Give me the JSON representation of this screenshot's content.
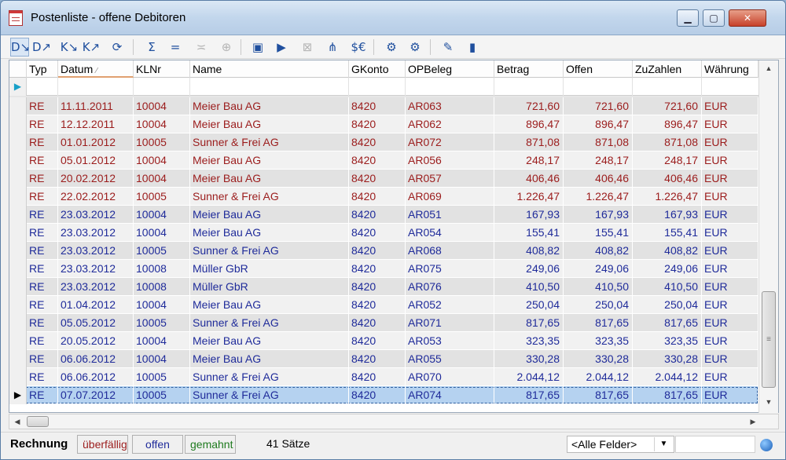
{
  "window": {
    "title": "Postenliste - offene Debitoren",
    "minimize": "▁",
    "maximize": "▢",
    "close": "✕"
  },
  "toolbar": {
    "icons": [
      "D↘",
      "D↗",
      "K↘",
      "K↗",
      "⟳",
      "Σ",
      "=",
      "≍",
      "⊕",
      "▣",
      "▶",
      "⊠",
      "⋔",
      "$€",
      "⚙",
      "⚙",
      "✎",
      "▮"
    ]
  },
  "grid": {
    "columns": [
      "Typ",
      "Datum",
      "KLNr",
      "Name",
      "GKonto",
      "OPBeleg",
      "Betrag",
      "Offen",
      "ZuZahlen",
      "Währung"
    ],
    "sort_indicator": "⁄",
    "new_row_marker": "▶",
    "current_row_marker": "▶",
    "rows": [
      {
        "typ": "RE",
        "datum": "11.11.2011",
        "klnr": "10004",
        "name": "Meier Bau AG",
        "gkonto": "8420",
        "opbeleg": "AR063",
        "betrag": "721,60",
        "offen": "721,60",
        "zuzahlen": "721,60",
        "waehrung": "EUR",
        "status": "overdue"
      },
      {
        "typ": "RE",
        "datum": "12.12.2011",
        "klnr": "10004",
        "name": "Meier Bau AG",
        "gkonto": "8420",
        "opbeleg": "AR062",
        "betrag": "896,47",
        "offen": "896,47",
        "zuzahlen": "896,47",
        "waehrung": "EUR",
        "status": "overdue"
      },
      {
        "typ": "RE",
        "datum": "01.01.2012",
        "klnr": "10005",
        "name": "Sunner & Frei AG",
        "gkonto": "8420",
        "opbeleg": "AR072",
        "betrag": "871,08",
        "offen": "871,08",
        "zuzahlen": "871,08",
        "waehrung": "EUR",
        "status": "overdue"
      },
      {
        "typ": "RE",
        "datum": "05.01.2012",
        "klnr": "10004",
        "name": "Meier Bau AG",
        "gkonto": "8420",
        "opbeleg": "AR056",
        "betrag": "248,17",
        "offen": "248,17",
        "zuzahlen": "248,17",
        "waehrung": "EUR",
        "status": "overdue"
      },
      {
        "typ": "RE",
        "datum": "20.02.2012",
        "klnr": "10004",
        "name": "Meier Bau AG",
        "gkonto": "8420",
        "opbeleg": "AR057",
        "betrag": "406,46",
        "offen": "406,46",
        "zuzahlen": "406,46",
        "waehrung": "EUR",
        "status": "overdue"
      },
      {
        "typ": "RE",
        "datum": "22.02.2012",
        "klnr": "10005",
        "name": "Sunner & Frei AG",
        "gkonto": "8420",
        "opbeleg": "AR069",
        "betrag": "1.226,47",
        "offen": "1.226,47",
        "zuzahlen": "1.226,47",
        "waehrung": "EUR",
        "status": "overdue"
      },
      {
        "typ": "RE",
        "datum": "23.03.2012",
        "klnr": "10004",
        "name": "Meier Bau AG",
        "gkonto": "8420",
        "opbeleg": "AR051",
        "betrag": "167,93",
        "offen": "167,93",
        "zuzahlen": "167,93",
        "waehrung": "EUR",
        "status": "open"
      },
      {
        "typ": "RE",
        "datum": "23.03.2012",
        "klnr": "10004",
        "name": "Meier Bau AG",
        "gkonto": "8420",
        "opbeleg": "AR054",
        "betrag": "155,41",
        "offen": "155,41",
        "zuzahlen": "155,41",
        "waehrung": "EUR",
        "status": "open"
      },
      {
        "typ": "RE",
        "datum": "23.03.2012",
        "klnr": "10005",
        "name": "Sunner & Frei AG",
        "gkonto": "8420",
        "opbeleg": "AR068",
        "betrag": "408,82",
        "offen": "408,82",
        "zuzahlen": "408,82",
        "waehrung": "EUR",
        "status": "open"
      },
      {
        "typ": "RE",
        "datum": "23.03.2012",
        "klnr": "10008",
        "name": "Müller GbR",
        "gkonto": "8420",
        "opbeleg": "AR075",
        "betrag": "249,06",
        "offen": "249,06",
        "zuzahlen": "249,06",
        "waehrung": "EUR",
        "status": "open"
      },
      {
        "typ": "RE",
        "datum": "23.03.2012",
        "klnr": "10008",
        "name": "Müller GbR",
        "gkonto": "8420",
        "opbeleg": "AR076",
        "betrag": "410,50",
        "offen": "410,50",
        "zuzahlen": "410,50",
        "waehrung": "EUR",
        "status": "open"
      },
      {
        "typ": "RE",
        "datum": "01.04.2012",
        "klnr": "10004",
        "name": "Meier Bau AG",
        "gkonto": "8420",
        "opbeleg": "AR052",
        "betrag": "250,04",
        "offen": "250,04",
        "zuzahlen": "250,04",
        "waehrung": "EUR",
        "status": "open"
      },
      {
        "typ": "RE",
        "datum": "05.05.2012",
        "klnr": "10005",
        "name": "Sunner & Frei AG",
        "gkonto": "8420",
        "opbeleg": "AR071",
        "betrag": "817,65",
        "offen": "817,65",
        "zuzahlen": "817,65",
        "waehrung": "EUR",
        "status": "open"
      },
      {
        "typ": "RE",
        "datum": "20.05.2012",
        "klnr": "10004",
        "name": "Meier Bau AG",
        "gkonto": "8420",
        "opbeleg": "AR053",
        "betrag": "323,35",
        "offen": "323,35",
        "zuzahlen": "323,35",
        "waehrung": "EUR",
        "status": "open"
      },
      {
        "typ": "RE",
        "datum": "06.06.2012",
        "klnr": "10004",
        "name": "Meier Bau AG",
        "gkonto": "8420",
        "opbeleg": "AR055",
        "betrag": "330,28",
        "offen": "330,28",
        "zuzahlen": "330,28",
        "waehrung": "EUR",
        "status": "open"
      },
      {
        "typ": "RE",
        "datum": "06.06.2012",
        "klnr": "10005",
        "name": "Sunner & Frei AG",
        "gkonto": "8420",
        "opbeleg": "AR070",
        "betrag": "2.044,12",
        "offen": "2.044,12",
        "zuzahlen": "2.044,12",
        "waehrung": "EUR",
        "status": "open"
      },
      {
        "typ": "RE",
        "datum": "07.07.2012",
        "klnr": "10005",
        "name": "Sunner & Frei AG",
        "gkonto": "8420",
        "opbeleg": "AR074",
        "betrag": "817,65",
        "offen": "817,65",
        "zuzahlen": "817,65",
        "waehrung": "EUR",
        "status": "open",
        "current": true
      }
    ]
  },
  "scrollbars": {
    "up": "▲",
    "down": "▼",
    "left": "◀",
    "right": "▶",
    "grip": "≡"
  },
  "statusbar": {
    "label": "Rechnung",
    "legend_overdue": "überfällig",
    "legend_open": "offen",
    "legend_reminded": "gemahnt",
    "count": "41 Sätze",
    "field_filter": "<Alle Felder>",
    "field_filter_arrow": "▼"
  },
  "colors": {
    "overdue": "#9b1c1c",
    "open": "#1f2b9a",
    "reminded": "#1e7a1e"
  }
}
